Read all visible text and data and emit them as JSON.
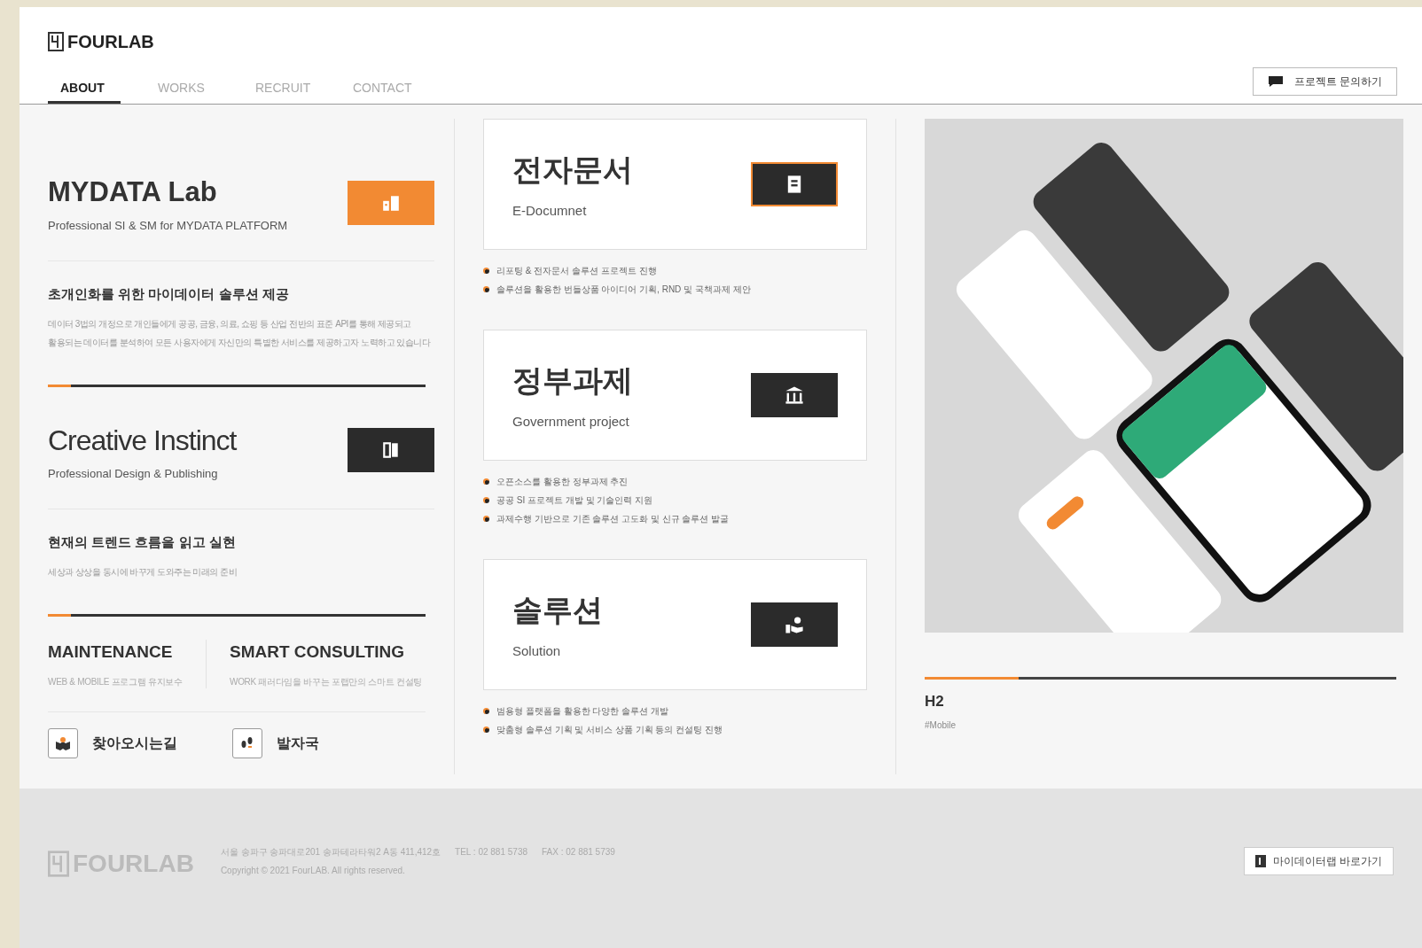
{
  "header": {
    "logo": "FOURLAB",
    "nav": [
      {
        "label": "ABOUT",
        "selected": true
      },
      {
        "label": "WORKS",
        "selected": false
      },
      {
        "label": "RECRUIT",
        "selected": false
      },
      {
        "label": "CONTACT",
        "selected": false
      }
    ],
    "inquiry_button": "프로젝트 문의하기"
  },
  "about": {
    "labs": [
      {
        "title": "MYDATA Lab",
        "subtitle": "Professional SI & SM for MYDATA PLATFORM",
        "highlighted": true,
        "heading": "초개인화를 위한 마이데이터 솔루션 제공",
        "description": [
          "데이터 3법의 개정으로 개인들에게 공공, 금융, 의료, 쇼핑 등 산업 전반의 표준 API를 통해 제공되고",
          "활용되는 데이터를 분석하여 모든 사용자에게 자신만의 특별한 서비스를 제공하고자 노력하고 있습니다"
        ],
        "level": 0.06
      },
      {
        "title": "Creative Instinct",
        "subtitle": "Professional Design & Publishing",
        "highlighted": false,
        "heading": "현재의 트렌드 흐름을 읽고 실현",
        "description": [
          "세상과 상상을 동시에 바꾸게 도와주는 미래의 준비"
        ],
        "level": 0.06
      }
    ],
    "services": [
      {
        "title": "MAINTENANCE",
        "subtitle": "WEB & MOBILE 프로그램 유지보수"
      },
      {
        "title": "SMART CONSULTING",
        "subtitle": "WORK 패러다임을 바꾸는 포랩만의 스마트 컨설팅"
      }
    ],
    "links": [
      {
        "kind": "map",
        "label": "찾아오시는길"
      },
      {
        "kind": "footprint",
        "label": "발자국"
      }
    ]
  },
  "business": [
    {
      "kind": "document",
      "title": "전자문서",
      "subtitle": "E-Documnet",
      "highlighted": true,
      "bullets": [
        "리포팅 & 전자문서 솔루션 프로젝트 진행",
        "솔루션을 활용한 번들상품 아이디어 기획, RND 및 국책과제 제안"
      ]
    },
    {
      "kind": "government",
      "title": "정부과제",
      "subtitle": "Government project",
      "highlighted": false,
      "bullets": [
        "오픈소스를 활용한 정부과제 추진",
        "공공 SI 프로젝트 개발 및 기술인력 지원",
        "과제수행 기반으로 기존 솔루션 고도화 및 신규 솔루션 발굴"
      ]
    },
    {
      "kind": "solution",
      "title": "솔루션",
      "subtitle": "Solution",
      "highlighted": false,
      "bullets": [
        "범용형 플랫폼을 활용한 다양한 솔루션 개발",
        "맞춤형 솔루션 기획 및 서비스 상품 기획 등의 컨설팅 진행"
      ]
    }
  ],
  "works": {
    "level": 0.2,
    "title": "H2",
    "tag": "#Mobile"
  },
  "footer": {
    "logo": "FOURLAB",
    "address": "서울 송파구 송파대로201 송파테라타워2 A동 411,412호",
    "tel": "TEL : 02 881 5738",
    "fax": "FAX : 02 881 5739",
    "copyright": "Copyright © 2021 FourLAB. All rights reserved.",
    "button": "마이데이터랩 바로가기"
  }
}
